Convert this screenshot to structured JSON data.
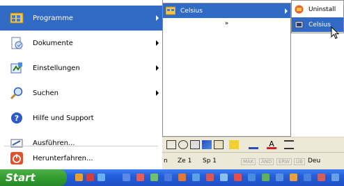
{
  "start_menu": {
    "items": [
      {
        "label": "Programme",
        "icon": "programs-icon",
        "submenu": true,
        "active": true
      },
      {
        "label": "Dokumente",
        "icon": "documents-icon",
        "submenu": true,
        "active": false
      },
      {
        "label": "Einstellungen",
        "icon": "settings-icon",
        "submenu": true,
        "active": false
      },
      {
        "label": "Suchen",
        "icon": "search-icon",
        "submenu": true,
        "active": false
      },
      {
        "label": "Hilfe und Support",
        "icon": "help-icon",
        "submenu": false,
        "active": false
      },
      {
        "label": "Ausführen...",
        "icon": "run-icon",
        "submenu": false,
        "active": false
      },
      {
        "label": "Herunterfahren...",
        "icon": "shutdown-icon",
        "submenu": false,
        "active": false
      }
    ]
  },
  "programs_submenu": {
    "item_label": "Celsius",
    "expand_glyph": "»"
  },
  "celsius_submenu": {
    "items": [
      {
        "label": "Uninstall",
        "icon": "uninstall-icon",
        "active": false
      },
      {
        "label": "Celsius",
        "icon": "celsius-app-icon",
        "active": true
      }
    ]
  },
  "statusbar": {
    "page": "Ze 1",
    "column": "Sp 1",
    "mak": "MAK",
    "and": "ÄND",
    "erw": "ERW",
    "ub": "ÜB",
    "lang": "Deu"
  },
  "taskbar": {
    "start_label": "Start"
  },
  "colors": {
    "highlight": "#316ac5",
    "taskbar": "#245edb",
    "start_button": "#2f9a2c",
    "menu_background": "#ffffff"
  }
}
